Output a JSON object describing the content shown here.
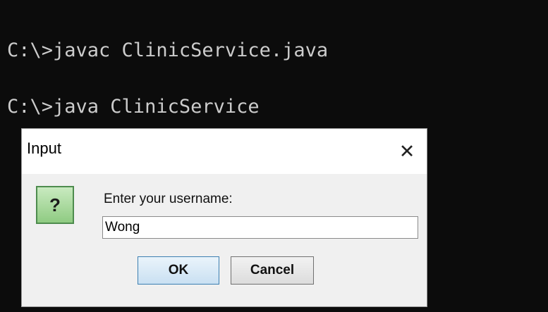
{
  "console": {
    "lines": [
      "C:\\>javac ClinicService.java",
      "C:\\>java ClinicService"
    ]
  },
  "dialog": {
    "title": "Input",
    "close_label": "✕",
    "icon_glyph": "?",
    "prompt": "Enter your username:",
    "input_value": "Wong",
    "ok_label": "OK",
    "cancel_label": "Cancel"
  }
}
